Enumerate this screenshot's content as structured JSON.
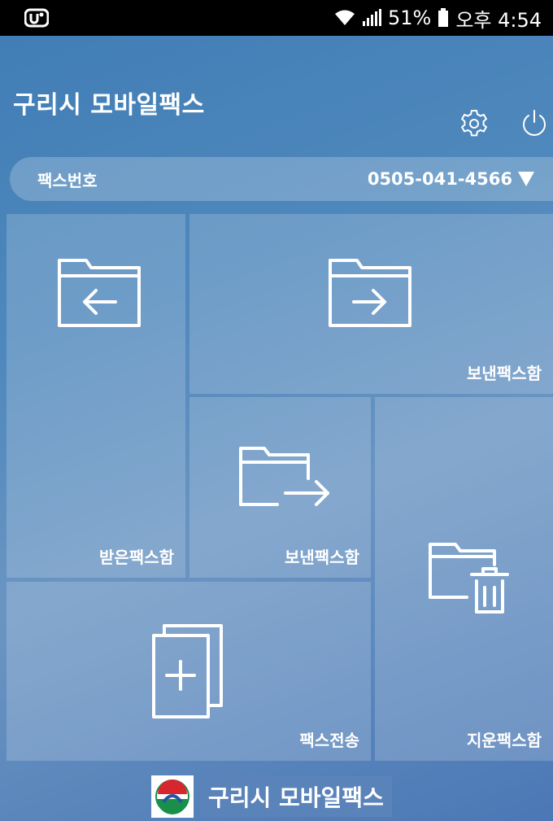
{
  "status": {
    "battery": "51%",
    "time": "오후 4:54"
  },
  "header": {
    "title": "구리시 모바일팩스"
  },
  "fax": {
    "label": "팩스번호",
    "number": "0505-041-4566"
  },
  "tiles": {
    "received": "받은팩스함",
    "sent_top": "보낸팩스함",
    "sent_middle": "보낸팩스함",
    "send_fax": "팩스전송",
    "deleted": "지운팩스함"
  },
  "footer": {
    "logo_text": "구리시 모바일팩스"
  },
  "colors": {
    "background": "#4f88bc",
    "tile": "rgba(255,255,255,0.18)",
    "text": "#ffffff"
  },
  "icons": {
    "settings": "gear-icon",
    "power": "power-icon",
    "received": "folder-arrow-left-icon",
    "sent": "folder-arrow-right-icon",
    "sent_out": "folder-export-icon",
    "send": "document-add-icon",
    "deleted": "folder-trash-icon"
  }
}
